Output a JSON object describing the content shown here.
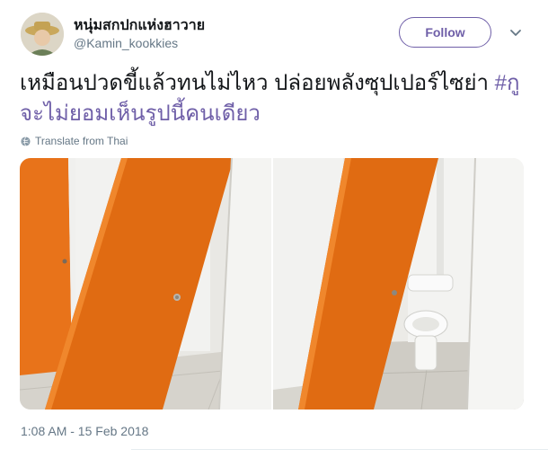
{
  "tweet": {
    "display_name": "หนุ่มสกปกแห่งฮาวาย",
    "handle": "@Kamin_kookkies",
    "follow_label": "Follow",
    "text_part1": "เหมือนปวดขี้แล้วทนไม่ไหว ปล่อยพลังซุปเปอร์ไซย่า ",
    "hashtag": "#กูจะไม่ยอมเห็นรูปนี้คนเดียว",
    "translate_label": "Translate from Thai",
    "timestamp": "1:08 AM - 15 Feb 2018"
  },
  "colors": {
    "accent": "#6f5fa8",
    "door_orange": "#e8731a",
    "secondary_text": "#657786"
  },
  "icons": {
    "more": "chevron-down-icon",
    "translate": "globe-icon"
  }
}
